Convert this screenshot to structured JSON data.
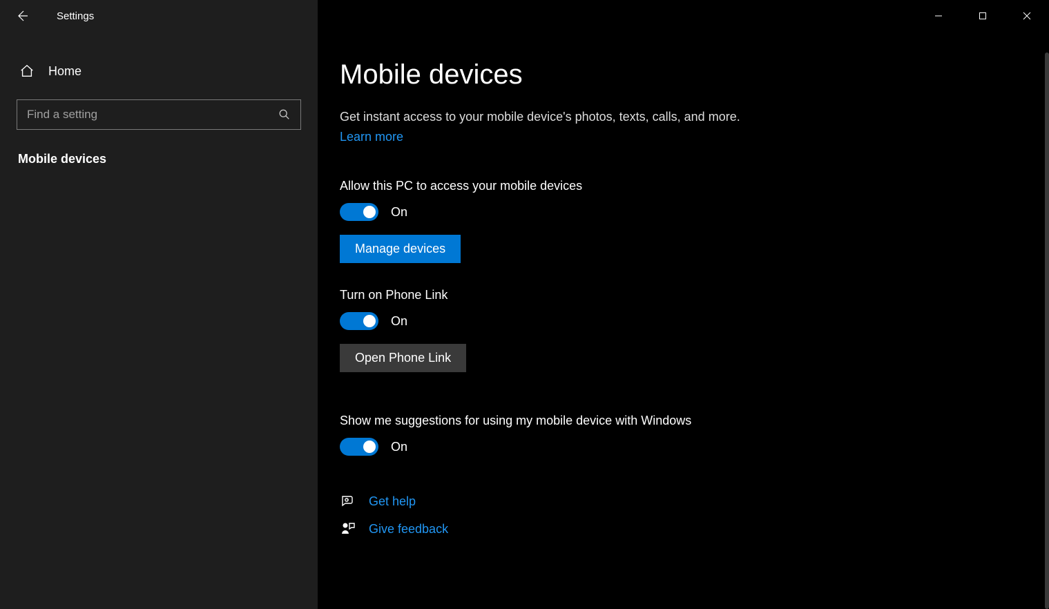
{
  "app": {
    "title": "Settings"
  },
  "sidebar": {
    "home_label": "Home",
    "search_placeholder": "Find a setting",
    "nav_item": "Mobile devices"
  },
  "main": {
    "title": "Mobile devices",
    "description": "Get instant access to your mobile device's photos, texts, calls, and more.",
    "learn_more": "Learn more",
    "allow": {
      "label": "Allow this PC to access your mobile devices",
      "state": "On",
      "button": "Manage devices"
    },
    "phonelink": {
      "label": "Turn on Phone Link",
      "state": "On",
      "button": "Open Phone Link"
    },
    "suggestions": {
      "label": "Show me suggestions for using my mobile device with Windows",
      "state": "On"
    },
    "help": {
      "get_help": "Get help",
      "give_feedback": "Give feedback"
    }
  }
}
